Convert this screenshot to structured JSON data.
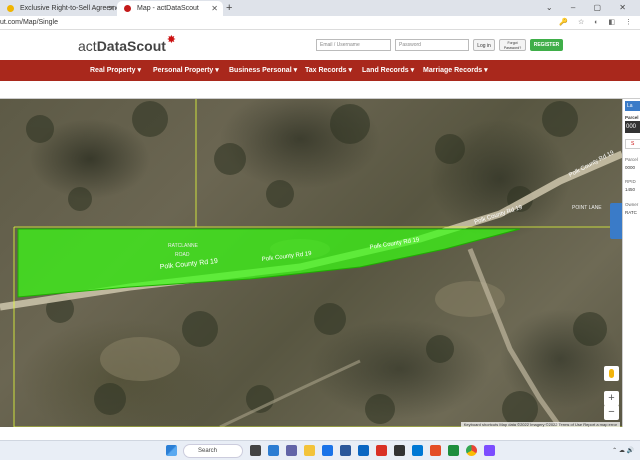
{
  "browser": {
    "tabs": [
      {
        "label": "Exclusive Right-to-Sell Agreeme",
        "favicon_color": "#f0b400",
        "active": false
      },
      {
        "label": "Map - actDataScout",
        "favicon_color": "#c41a1a",
        "active": true
      }
    ],
    "new_tab": "+",
    "window_controls": "⌄ – ▢ ✕",
    "url": "ut.com/Map/Single",
    "address_icons": "🔑 ☆ ◐ ◧ ⋮"
  },
  "site": {
    "logo_light": "act",
    "logo_bold": "DataScout",
    "login": {
      "email_placeholder": "Email / Username",
      "password_placeholder": "Password",
      "login_label": "Log in",
      "forgot_label": "Forgot Password?",
      "register_label": "REGISTER"
    },
    "nav": [
      "Real Property ▾",
      "Personal Property ▾",
      "Business Personal ▾",
      "Tax Records ▾",
      "Land Records ▾",
      "Marriage Records ▾"
    ]
  },
  "map": {
    "road_labels": [
      "Polk County Rd 19",
      "Polk County Rd 19",
      "Polk County Rd 19",
      "Polk County Rd 19",
      "Polk County Rd 19"
    ],
    "parcel_labels": [
      "RATCLANNE",
      "ROAD",
      "POINT LANE"
    ],
    "attribution": "Keyboard shortcuts   Map data ©2022 Imagery ©2022   Terms of Use   Report a map error",
    "zoom_in": "+",
    "zoom_out": "−",
    "colors": {
      "parcel_fill": "#39ff14",
      "parcel_line": "#e6ff3a",
      "road": "#cfc7ad"
    }
  },
  "side_panel": {
    "tab_label": "La",
    "parcel_header": "Parcel",
    "parcel_id": "000",
    "labels": [
      "Parcel",
      "0000",
      "RPID",
      "1450",
      "Owner",
      "RATC"
    ],
    "button_label": "S"
  },
  "taskbar": {
    "search_label": "Search",
    "clock": "⌃  ☁  🔊"
  }
}
